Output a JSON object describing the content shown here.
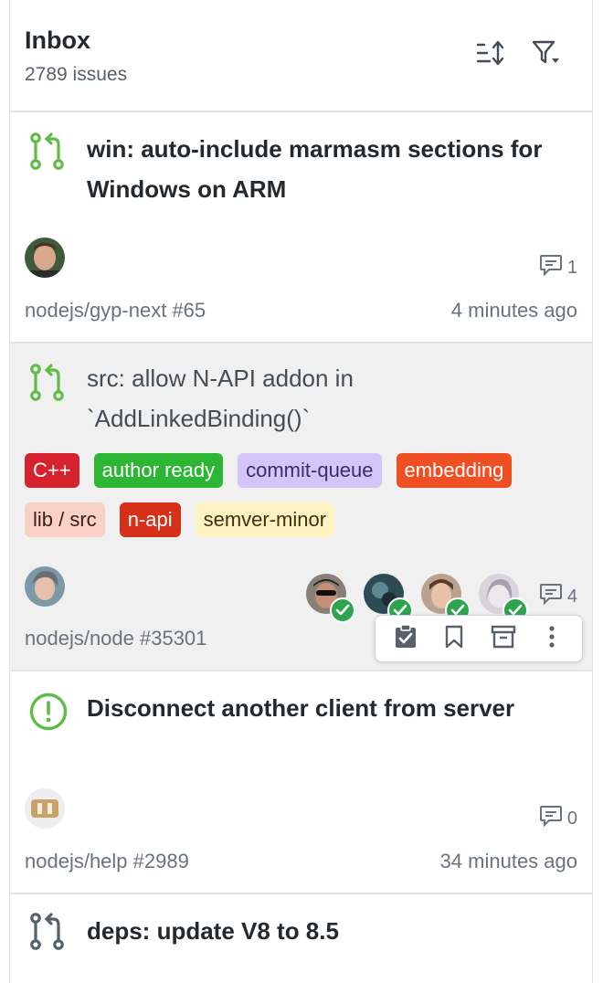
{
  "header": {
    "title": "Inbox",
    "count": "2789 issues",
    "sort_icon": "sort-icon",
    "filter_icon": "filter-icon"
  },
  "items": [
    {
      "type": "pull-request",
      "title": "win: auto-include marmasm sections for Windows on ARM",
      "unread": true,
      "repo": "nodejs/gyp-next #65",
      "time": "4 minutes ago",
      "comments": "1"
    },
    {
      "type": "pull-request",
      "title": "src: allow N-API addon in `AddLinkedBinding()`",
      "unread": false,
      "labels": [
        {
          "text": "C++",
          "bg": "#d6222c",
          "fg": "#ffffff"
        },
        {
          "text": "author ready",
          "bg": "#2db534",
          "fg": "#ffffff"
        },
        {
          "text": "commit-queue",
          "bg": "#d4c5f9",
          "fg": "#3b2d6a"
        },
        {
          "text": "embedding",
          "bg": "#f04e23",
          "fg": "#ffffff"
        },
        {
          "text": "lib / src",
          "bg": "#f9d0c4",
          "fg": "#3a1d14"
        },
        {
          "text": "n-api",
          "bg": "#d63118",
          "fg": "#ffffff"
        },
        {
          "text": "semver-minor",
          "bg": "#fef2c0",
          "fg": "#3a3212"
        }
      ],
      "repo": "nodejs/node #35301",
      "comments": "4",
      "actions": [
        "mark-done-icon",
        "bookmark-icon",
        "archive-icon",
        "more-icon"
      ]
    },
    {
      "type": "issue",
      "title": "Disconnect another client from server",
      "unread": true,
      "repo": "nodejs/help #2989",
      "time": "34 minutes ago",
      "comments": "0"
    },
    {
      "type": "pull-request",
      "title": "deps: update V8 to 8.5",
      "unread": true
    }
  ],
  "colors": {
    "accent_green": "#2ea44f",
    "muted": "#6a737d",
    "border": "#e1e4e8"
  }
}
